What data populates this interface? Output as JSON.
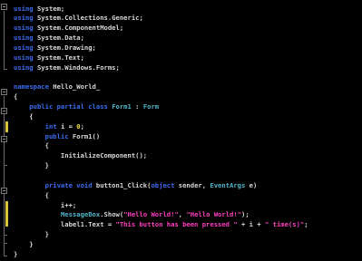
{
  "editor": {
    "lines": [
      [
        {
          "t": "using ",
          "c": "kw"
        },
        {
          "t": "System;",
          "c": "tx"
        }
      ],
      [
        {
          "t": "using ",
          "c": "kw"
        },
        {
          "t": "System.Collections.Generic;",
          "c": "tx"
        }
      ],
      [
        {
          "t": "using ",
          "c": "kw"
        },
        {
          "t": "System.ComponentModel;",
          "c": "tx"
        }
      ],
      [
        {
          "t": "using ",
          "c": "kw"
        },
        {
          "t": "System.Data;",
          "c": "tx"
        }
      ],
      [
        {
          "t": "using ",
          "c": "kw"
        },
        {
          "t": "System.Drawing;",
          "c": "tx"
        }
      ],
      [
        {
          "t": "using ",
          "c": "kw"
        },
        {
          "t": "System.Text;",
          "c": "tx"
        }
      ],
      [
        {
          "t": "using ",
          "c": "kw"
        },
        {
          "t": "System.Windows.Forms;",
          "c": "tx"
        }
      ],
      [],
      [
        {
          "t": "namespace ",
          "c": "kw"
        },
        {
          "t": "Hello_World_",
          "c": "tx"
        }
      ],
      [
        {
          "t": "{",
          "c": "pu"
        }
      ],
      [
        {
          "t": "    public partial class ",
          "c": "kw"
        },
        {
          "t": "Form1",
          "c": "ty"
        },
        {
          "t": " : ",
          "c": "tx"
        },
        {
          "t": "Form",
          "c": "ty"
        }
      ],
      [
        {
          "t": "    {",
          "c": "pu"
        }
      ],
      [
        {
          "t": "        int ",
          "c": "kw"
        },
        {
          "t": "i = ",
          "c": "tx"
        },
        {
          "t": "0",
          "c": "nm"
        },
        {
          "t": ";",
          "c": "tx"
        }
      ],
      [
        {
          "t": "        public ",
          "c": "kw"
        },
        {
          "t": "Form1()",
          "c": "tx"
        }
      ],
      [
        {
          "t": "        {",
          "c": "pu"
        }
      ],
      [
        {
          "t": "            InitializeComponent();",
          "c": "tx"
        }
      ],
      [
        {
          "t": "        }",
          "c": "pu"
        }
      ],
      [],
      [
        {
          "t": "        private void ",
          "c": "kw"
        },
        {
          "t": "button1_Click(",
          "c": "tx"
        },
        {
          "t": "object ",
          "c": "kw"
        },
        {
          "t": "sender, ",
          "c": "tx"
        },
        {
          "t": "EventArgs ",
          "c": "ty"
        },
        {
          "t": "e)",
          "c": "tx"
        }
      ],
      [
        {
          "t": "        {",
          "c": "pu"
        }
      ],
      [
        {
          "t": "            i++;",
          "c": "tx"
        }
      ],
      [
        {
          "t": "            ",
          "c": "tx"
        },
        {
          "t": "MessageBox",
          "c": "ty"
        },
        {
          "t": ".Show(",
          "c": "tx"
        },
        {
          "t": "\"Hello World!\"",
          "c": "st"
        },
        {
          "t": ", ",
          "c": "tx"
        },
        {
          "t": "\"Hello World!\"",
          "c": "st"
        },
        {
          "t": ");",
          "c": "tx"
        }
      ],
      [
        {
          "t": "            label1.Text = ",
          "c": "tx"
        },
        {
          "t": "\"This button has been pressed \"",
          "c": "st"
        },
        {
          "t": " + i + ",
          "c": "tx"
        },
        {
          "t": "\" time(s)\"",
          "c": "st"
        },
        {
          "t": ";",
          "c": "tx"
        }
      ],
      [
        {
          "t": "        }",
          "c": "pu"
        }
      ],
      [
        {
          "t": "    }",
          "c": "pu"
        }
      ],
      [
        {
          "t": "}",
          "c": "pu"
        }
      ]
    ]
  }
}
